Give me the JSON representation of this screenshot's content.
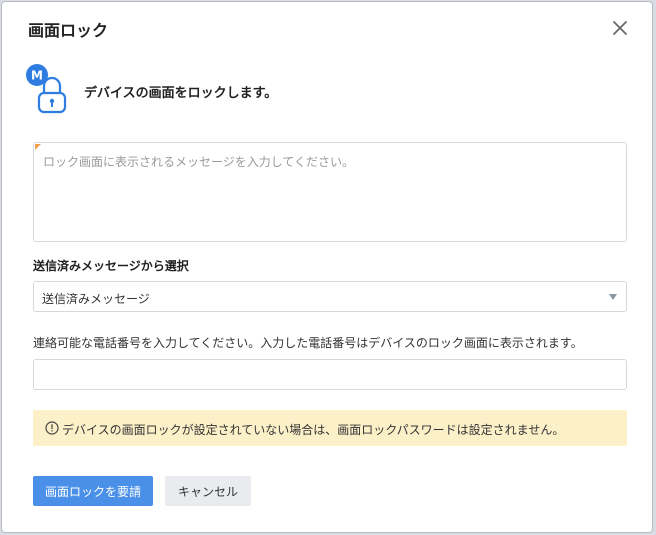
{
  "dialog": {
    "title": "画面ロック",
    "heading": "デバイスの画面をロックします。",
    "badge_letter": "M",
    "message": {
      "placeholder": "ロック画面に表示されるメッセージを入力してください。",
      "value": ""
    },
    "sent_select": {
      "label": "送信済みメッセージから選択",
      "selected": "送信済みメッセージ"
    },
    "phone": {
      "label": "連絡可能な電話番号を入力してください。入力した電話番号はデバイスのロック画面に表示されます。",
      "value": ""
    },
    "notice": {
      "text": "デバイスの画面ロックが設定されていない場合は、画面ロックパスワードは設定されません。"
    },
    "buttons": {
      "primary": "画面ロックを要請",
      "cancel": "キャンセル"
    }
  },
  "icons": {
    "close": "close-icon",
    "lock": "lock-icon",
    "info": "info-icon",
    "dropdown": "chevron-down-icon"
  },
  "colors": {
    "primary": "#4a90e8",
    "notice_bg": "#fcf0c8",
    "badge": "#2f7de1"
  }
}
